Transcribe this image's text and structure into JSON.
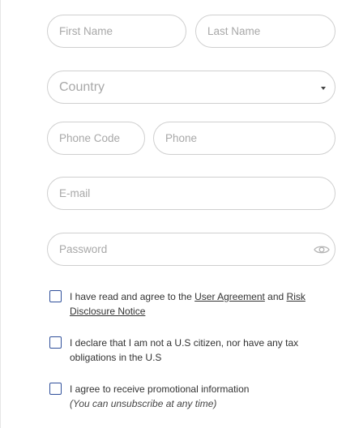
{
  "form": {
    "first_name": {
      "placeholder": "First Name",
      "value": ""
    },
    "last_name": {
      "placeholder": "Last Name",
      "value": ""
    },
    "country": {
      "placeholder": "Country"
    },
    "phone_code": {
      "placeholder": "Phone Code",
      "value": ""
    },
    "phone": {
      "placeholder": "Phone",
      "value": ""
    },
    "email": {
      "placeholder": "E-mail",
      "value": ""
    },
    "password": {
      "placeholder": "Password",
      "value": ""
    }
  },
  "checkboxes": {
    "agreement": {
      "checked": false,
      "prefix": "I have read and agree to the ",
      "link1": "User Agreement",
      "middle": " and ",
      "link2": "Risk Disclosure Notice"
    },
    "us_citizen": {
      "checked": false,
      "text": "I declare that I am not a U.S citizen, nor have any tax obligations in the U.S"
    },
    "promo": {
      "checked": false,
      "text": "I agree to receive promotional information",
      "subtext": "(You can unsubscribe at any time)"
    }
  },
  "icons": {
    "caret": "chevron-down-icon",
    "password_toggle": "eye-icon"
  },
  "colors": {
    "input_border": "#cfcfcf",
    "placeholder": "#a8a8a8",
    "checkbox_border": "#2f4f9a",
    "text": "#333333"
  }
}
